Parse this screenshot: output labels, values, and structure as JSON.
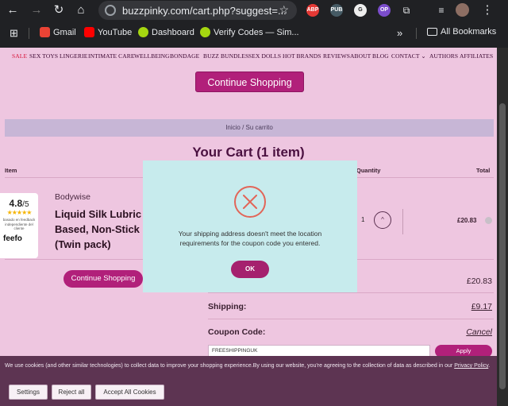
{
  "browser": {
    "url": "buzzpinky.com/cart.php?suggest=...",
    "extensions": [
      "ABP",
      "PUB",
      "G",
      "OP"
    ],
    "bookmarks": [
      {
        "label": "Gmail"
      },
      {
        "label": "YouTube"
      },
      {
        "label": "Dashboard"
      },
      {
        "label": "Verify Codes — Sim..."
      }
    ],
    "all_bookmarks": "All Bookmarks",
    "chevron": "»"
  },
  "nav": {
    "items": [
      "SALE",
      "SEX TOYS",
      "LINGERIE",
      "INTIMATE CARE",
      "WELLBEING",
      "BONDAGE",
      "BUZZ BUNDLES",
      "SEX DOLLS",
      "HOT BRANDS",
      "REVIEWS",
      "ABOUT",
      "BLOG",
      "CONTACT ⌄",
      "AUTHORS",
      "AFFILIATES"
    ]
  },
  "continue_top": "Continue Shopping",
  "breadcrumb": "Inicio / Su carrito",
  "cart_title": "Your Cart (1 item)",
  "columns": {
    "item": "Item",
    "quantity": "Quantity",
    "total": "Total"
  },
  "rating": {
    "score": "4.8",
    "out_of": "/5",
    "stars": "★★★★★",
    "text": "basado en feedback independiente del cliente",
    "brand": "feefo"
  },
  "product": {
    "brand": "Bodywise",
    "name_lines": [
      "Liquid Silk Lubric",
      "Based, Non-Stick",
      "(Twin pack)"
    ],
    "quantity": "1",
    "qty_up": "^",
    "price": "£20.83"
  },
  "continue_bottom": "Continue Shopping",
  "summary": {
    "subtotal": "£20.83",
    "shipping_label": "Shipping:",
    "shipping_value": "£9.17",
    "coupon_label": "Coupon Code:",
    "cancel": "Cancel",
    "coupon_value": "FREESHIPPINGUK",
    "apply": "Apply"
  },
  "modal": {
    "message": "Your shipping address doesn't meet the location requirements for the coupon code you entered.",
    "ok": "OK"
  },
  "cookie": {
    "text": "We use cookies (and other similar technologies) to collect data to improve your shopping experience.By using our website, you're agreeing to the collection of data as described in our",
    "policy": "Privacy Policy",
    "period": ".",
    "settings": "Settings",
    "reject": "Reject all",
    "accept": "Accept All Cookies"
  }
}
